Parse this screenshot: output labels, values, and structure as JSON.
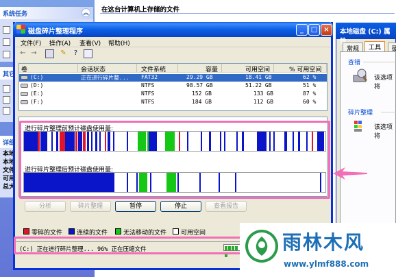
{
  "explorer": {
    "tasks_title": "系统任务",
    "other_title": "其它",
    "details_title": "详细",
    "detail_lines": [
      "本地",
      "本地",
      "文件",
      "可用",
      "总大"
    ],
    "heading": "在这台计算机上存储的文件"
  },
  "properties": {
    "title": "本地磁盘 (C:) 属性",
    "tabs": [
      "常规",
      "工具",
      "硬"
    ],
    "check_title": "查错",
    "check_text": "该选项将",
    "defrag_title": "碎片整理",
    "defrag_text": "该选项将"
  },
  "window": {
    "title": "磁盘碎片整理程序",
    "menu": [
      "文件(F)",
      "操作(A)",
      "查看(V)",
      "帮助(H)"
    ],
    "controls": [
      "_",
      "□",
      "×"
    ]
  },
  "volumes": {
    "columns": [
      "卷",
      "会话状态",
      "文件系统",
      "容量",
      "可用空间",
      "% 可用空间"
    ],
    "rows": [
      {
        "vol": "(C:)",
        "status": "正在进行碎片整...",
        "fs": "FAT32",
        "cap": "29.29 GB",
        "free": "18.41 GB",
        "pct": "62 %",
        "selected": true
      },
      {
        "vol": "(D:)",
        "status": "",
        "fs": "NTFS",
        "cap": "98.57 GB",
        "free": "51.22 GB",
        "pct": "51 %",
        "selected": false
      },
      {
        "vol": "(E:)",
        "status": "",
        "fs": "NTFS",
        "cap": "152 GB",
        "free": "133 GB",
        "pct": "87 %",
        "selected": false
      },
      {
        "vol": "(F:)",
        "status": "",
        "fs": "NTFS",
        "cap": "184 GB",
        "free": "112 GB",
        "pct": "60 %",
        "selected": false
      }
    ]
  },
  "analysis": {
    "before_label": "进行碎片整理前预计磁盘使用量:",
    "after_label": "进行碎片整理后预计磁盘使用量:"
  },
  "buttons": [
    "分析",
    "碎片整理",
    "暂停",
    "停止",
    "查看报告"
  ],
  "legend": [
    "零碎的文件",
    "连续的文件",
    "无法移动的文件",
    "可用空间"
  ],
  "colors": {
    "fragmented": "#e2142a",
    "contiguous": "#0a14c8",
    "unmovable": "#16c816",
    "free": "#ffffff",
    "highlight": "#f16fb7"
  },
  "status": {
    "text": "(C:) 正在进行碎片整理... 96%  正在压缩文件",
    "progress": 0.96
  },
  "watermark": {
    "name": "雨林木风",
    "url": "www.ylmf888.com"
  }
}
